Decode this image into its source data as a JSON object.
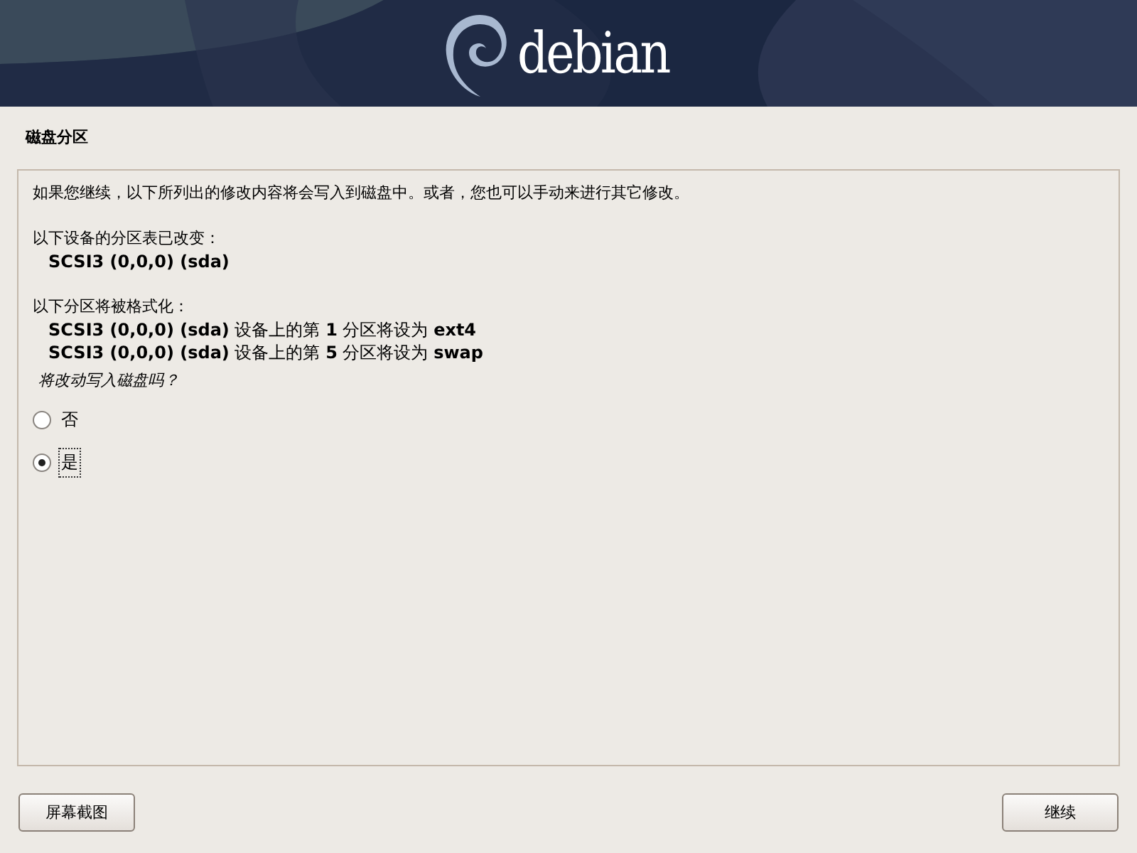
{
  "header": {
    "logo_text": "debian"
  },
  "page_title": "磁盘分区",
  "intro": "如果您继续，以下所列出的修改内容将会写入到磁盘中。或者，您也可以手动来进行其它修改。",
  "sections": [
    {
      "heading": "以下设备的分区表已改变：",
      "items": [
        "**SCSI3 (0,0,0) (sda)**"
      ]
    },
    {
      "heading": "以下分区将被格式化：",
      "items": [
        "**SCSI3 (0,0,0) (sda)** 设备上的第 **1** 分区将设为 **ext4**",
        "**SCSI3 (0,0,0) (sda)** 设备上的第 **5** 分区将设为 **swap**"
      ]
    }
  ],
  "question": "将改动写入磁盘吗？",
  "options": [
    {
      "label": "否",
      "selected": false
    },
    {
      "label": "是",
      "selected": true
    }
  ],
  "buttons": {
    "left": "屏幕截图",
    "right": "继续"
  }
}
